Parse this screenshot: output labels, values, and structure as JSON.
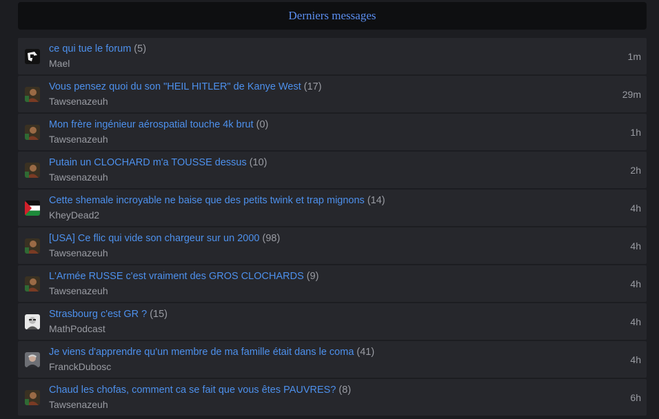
{
  "header": {
    "title": "Derniers messages"
  },
  "topics": [
    {
      "title": "ce qui tue le forum",
      "count": "(5)",
      "author": "Mael",
      "time": "1m",
      "avatar": "black-white-avatar-icon"
    },
    {
      "title": "Vous pensez quoi du son \"HEIL HITLER\" de Kanye West",
      "count": "(17)",
      "author": "Tawsenazeuh",
      "time": "29m",
      "avatar": "portrait-avatar-icon"
    },
    {
      "title": "Mon frère ingénieur aérospatial touche 4k brut",
      "count": "(0)",
      "author": "Tawsenazeuh",
      "time": "1h",
      "avatar": "portrait-avatar-icon"
    },
    {
      "title": "Putain un CLOCHARD m'a TOUSSE dessus",
      "count": "(10)",
      "author": "Tawsenazeuh",
      "time": "2h",
      "avatar": "portrait-avatar-icon"
    },
    {
      "title": "Cette shemale incroyable ne baise que des petits twink et trap mignons",
      "count": "(14)",
      "author": "KheyDead2",
      "time": "4h",
      "avatar": "flag-avatar-icon"
    },
    {
      "title": "[USA] Ce flic qui vide son chargeur sur un 2000",
      "count": "(98)",
      "author": "Tawsenazeuh",
      "time": "4h",
      "avatar": "portrait-avatar-icon"
    },
    {
      "title": "L'Armée RUSSE c'est vraiment des GROS CLOCHARDS",
      "count": "(9)",
      "author": "Tawsenazeuh",
      "time": "4h",
      "avatar": "portrait-avatar-icon"
    },
    {
      "title": "Strasbourg c'est GR ?",
      "count": "(15)",
      "author": "MathPodcast",
      "time": "4h",
      "avatar": "face-sketch-avatar-icon"
    },
    {
      "title": "Je viens d'apprendre qu'un membre de ma famille était dans le coma",
      "count": "(41)",
      "author": "FranckDubosc",
      "time": "4h",
      "avatar": "gray-portrait-avatar-icon"
    },
    {
      "title": "Chaud les chofas, comment ca se fait que vous êtes PAUVRES?",
      "count": "(8)",
      "author": "Tawsenazeuh",
      "time": "6h",
      "avatar": "portrait-avatar-icon"
    }
  ]
}
